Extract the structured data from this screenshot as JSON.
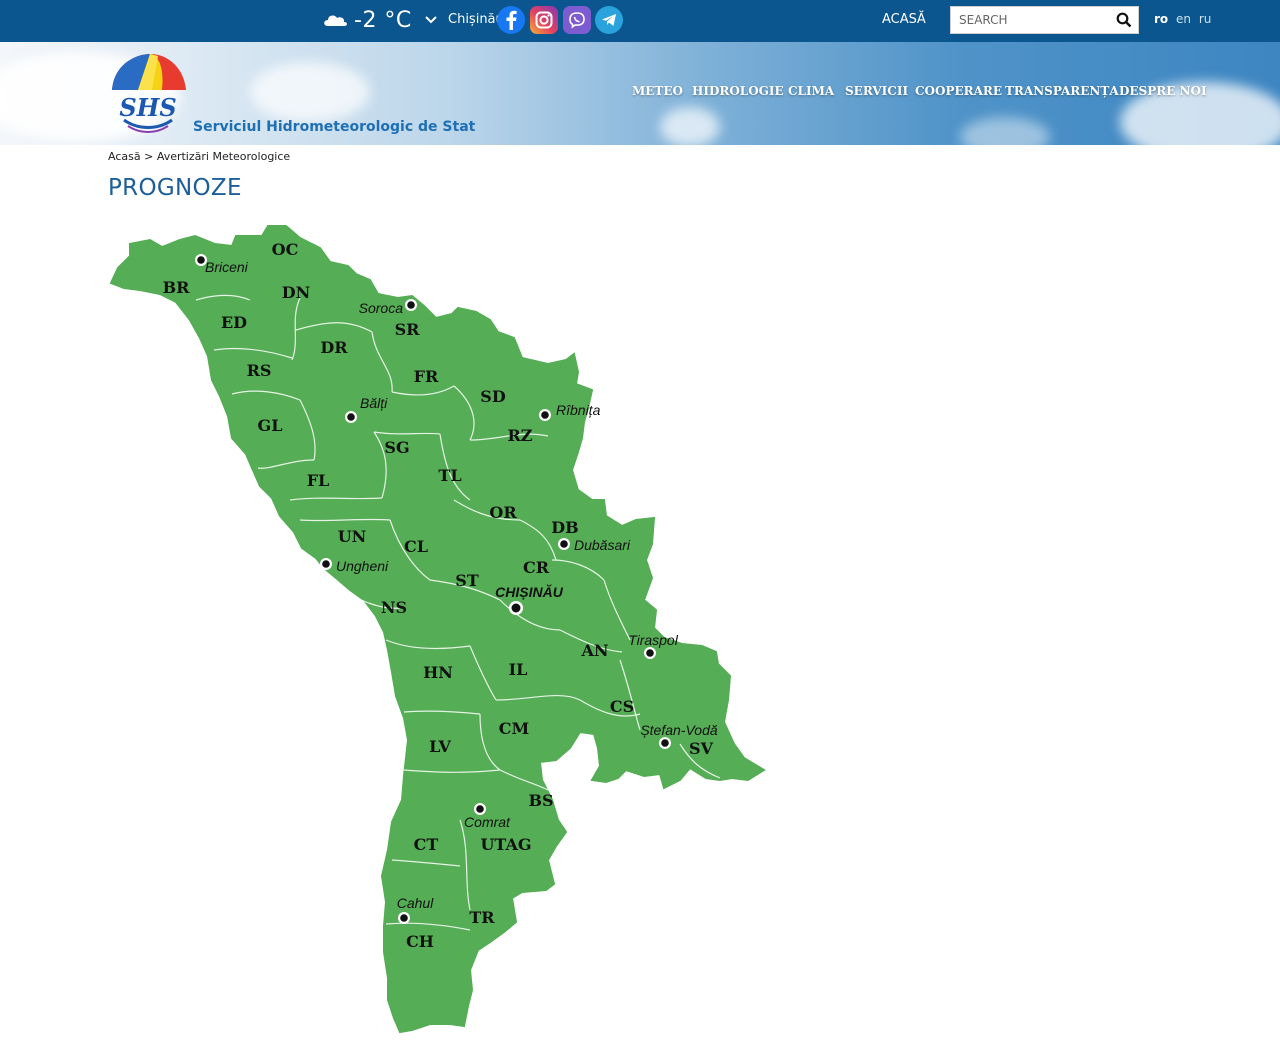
{
  "header": {
    "weather": {
      "icon": "cloud-icon",
      "temperature": "-2 °C",
      "city": "Chișinău"
    },
    "social": [
      "facebook-icon",
      "instagram-icon",
      "viber-icon",
      "telegram-icon"
    ],
    "home_link": "ACASĂ",
    "search": {
      "placeholder": "SEARCH",
      "value": ""
    },
    "languages": [
      {
        "code": "ro",
        "active": true
      },
      {
        "code": "en",
        "active": false
      },
      {
        "code": "ru",
        "active": false
      }
    ]
  },
  "brand": {
    "name": "Serviciul Hidrometeorologic de Stat",
    "logo_text": "SHS"
  },
  "nav": [
    "METEO",
    "HIDROLOGIE",
    "CLIMA",
    "SERVICII",
    "COOPERARE",
    "TRANSPARENȚA",
    "DESPRE NOI"
  ],
  "breadcrumb": {
    "home": "Acasă",
    "separator": ">",
    "current": "Avertizări Meteorologice"
  },
  "page_title": "PROGNOZE",
  "map": {
    "fill_color": "#55ad55",
    "border_color": "#ffffff",
    "districts": [
      "OC",
      "BR",
      "DN",
      "ED",
      "DR",
      "SR",
      "RS",
      "FR",
      "SD",
      "GL",
      "RZ",
      "SG",
      "TL",
      "FL",
      "OR",
      "DB",
      "UN",
      "CL",
      "CR",
      "ST",
      "NS",
      "AN",
      "HN",
      "IL",
      "CS",
      "SV",
      "LV",
      "CM",
      "BS",
      "CT",
      "UTAG",
      "TR",
      "CH"
    ],
    "cities": [
      "Briceni",
      "Soroca",
      "Bălți",
      "Rîbnița",
      "Dubăsari",
      "Ungheni",
      "CHIȘINĂU",
      "Tiraspol",
      "Ștefan-Vodă",
      "Comrat",
      "Cahul"
    ]
  }
}
